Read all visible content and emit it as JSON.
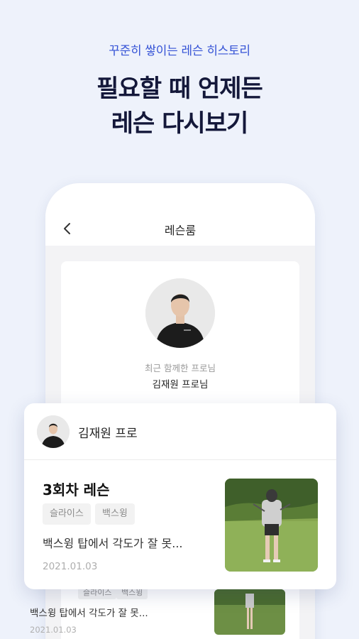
{
  "promo": {
    "subtitle": "꾸준히 쌓이는 레슨 히스토리",
    "title_line1": "필요할 때 언제든",
    "title_line2": "레슨 다시보기"
  },
  "screen": {
    "title": "레슨룸",
    "profile": {
      "recent_label": "최근 함께한 프로님",
      "recent_name": "김재원 프로님"
    }
  },
  "lesson_card": {
    "coach_name": "김재원 프로",
    "title": "3회차 레슨",
    "tags": [
      "슬라이스",
      "백스윙"
    ],
    "description": "백스윙 탑에서 각도가 잘 못...",
    "date": "2021.01.03"
  },
  "background_lesson": {
    "tags": [
      "슬라이스",
      "백스윙"
    ],
    "description": "백스윙 탑에서 각도가 잘 못...",
    "date": "2021.01.03"
  },
  "colors": {
    "background": "#eef2fb",
    "accent": "#3553d6",
    "title": "#14183a"
  }
}
